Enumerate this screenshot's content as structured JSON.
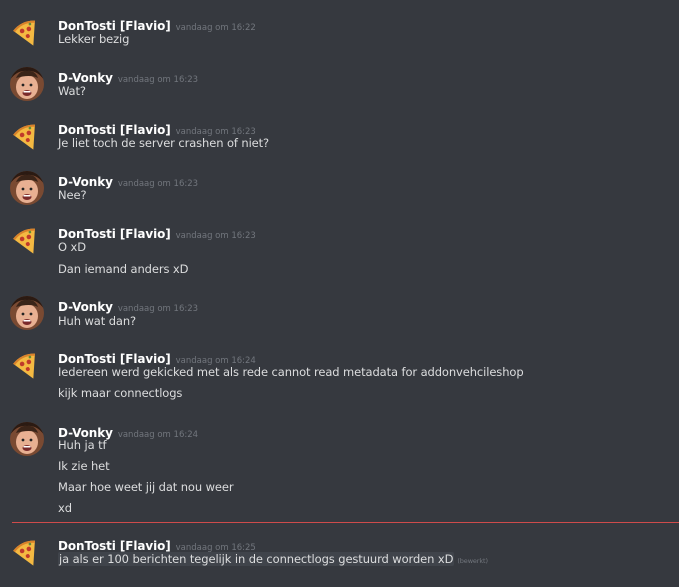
{
  "users": {
    "dontosti": "DonTosti [Flavio]",
    "dvonky": "D-Vonky"
  },
  "groups": [
    {
      "user": "DonTosti [Flavio]",
      "avatar": "pizza-icon",
      "time": "vandaag om 16:22",
      "messages": [
        "Lekker bezig"
      ]
    },
    {
      "user": "D-Vonky",
      "avatar": "face-avatar",
      "time": "vandaag om 16:23",
      "messages": [
        "Wat?"
      ]
    },
    {
      "user": "DonTosti [Flavio]",
      "avatar": "pizza-icon",
      "time": "vandaag om 16:23",
      "messages": [
        "Je liet toch de server crashen of niet?"
      ]
    },
    {
      "user": "D-Vonky",
      "avatar": "face-avatar",
      "time": "vandaag om 16:23",
      "messages": [
        "Nee?"
      ]
    },
    {
      "user": "DonTosti [Flavio]",
      "avatar": "pizza-icon",
      "time": "vandaag om 16:23",
      "messages": [
        "O xD",
        "Dan iemand anders xD"
      ]
    },
    {
      "user": "D-Vonky",
      "avatar": "face-avatar",
      "time": "vandaag om 16:23",
      "messages": [
        "Huh wat dan?"
      ]
    },
    {
      "user": "DonTosti [Flavio]",
      "avatar": "pizza-icon",
      "time": "vandaag om 16:24",
      "messages": [
        "Iedereen werd gekicked met als rede cannot read metadata for addonvehcileshop",
        "kijk maar connectlogs"
      ]
    },
    {
      "user": "D-Vonky",
      "avatar": "face-avatar",
      "time": "vandaag om 16:24",
      "messages": [
        "Huh ja tf",
        "Ik zie het",
        "Maar hoe weet jij dat nou weer",
        "xd"
      ]
    },
    {
      "user": "DonTosti [Flavio]",
      "avatar": "pizza-icon",
      "time": "vandaag om 16:25",
      "messages": [
        "ja als er 100 berichten tegelijk in de connectlogs gestuurd worden xD"
      ],
      "edited": "(bewerkt)"
    }
  ],
  "colors": {
    "background": "#36393f",
    "username": "#ffffff",
    "timestamp": "#72767d",
    "text": "#dcddde",
    "new_messages_divider": "#cf4b4b"
  }
}
